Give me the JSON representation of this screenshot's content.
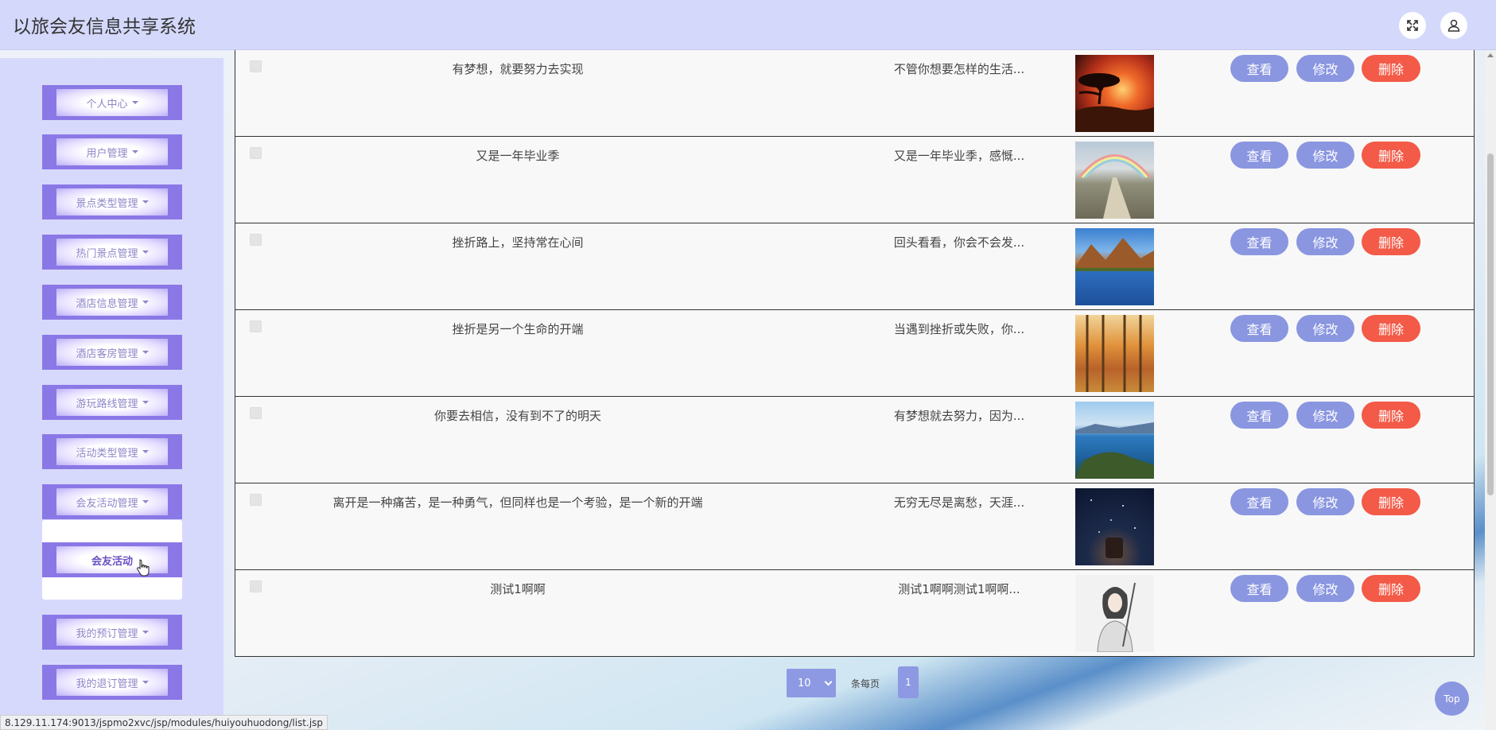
{
  "app": {
    "title": "以旅会友信息共享系统"
  },
  "sidebar": {
    "items": [
      {
        "label": "个人中心"
      },
      {
        "label": "用户管理"
      },
      {
        "label": "景点类型管理"
      },
      {
        "label": "热门景点管理"
      },
      {
        "label": "酒店信息管理"
      },
      {
        "label": "酒店客房管理"
      },
      {
        "label": "游玩路线管理"
      },
      {
        "label": "活动类型管理"
      },
      {
        "label": "会友活动管理"
      },
      {
        "label": "我的预订管理"
      },
      {
        "label": "我的退订管理"
      }
    ],
    "submenu": {
      "label": "会友活动"
    }
  },
  "table": {
    "rows": [
      {
        "title": "有梦想，就要努力去实现",
        "excerpt": "不管你想要怎样的生活...",
        "image": "sunset-tree"
      },
      {
        "title": "又是一年毕业季",
        "excerpt": "又是一年毕业季，感慨...",
        "image": "rainbow-path"
      },
      {
        "title": "挫折路上，坚持常在心间",
        "excerpt": "回头看看，你会不会发...",
        "image": "mountain-lake"
      },
      {
        "title": "挫折是另一个生命的开端",
        "excerpt": "当遇到挫折或失败，你...",
        "image": "autumn-forest"
      },
      {
        "title": "你要去相信，没有到不了的明天",
        "excerpt": "有梦想就去努力，因为...",
        "image": "lake-island"
      },
      {
        "title": "离开是一种痛苦，是一种勇气，但同样也是一个考验，是一个新的开端",
        "excerpt": "无穷无尽是离愁，天涯...",
        "image": "night-lantern"
      },
      {
        "title": "测试1啊啊",
        "excerpt": "测试1啊啊测试1啊啊...",
        "image": "anime-swordsman"
      }
    ],
    "actions": {
      "view": "查看",
      "edit": "修改",
      "delete": "删除"
    }
  },
  "pager": {
    "page_size": "10",
    "page_size_label": "条每页",
    "current_page": "1"
  },
  "top_button": "Top",
  "status_url": "8.129.11.174:9013/jspmo2xvc/jsp/modules/huiyouhuodong/list.jsp",
  "colors": {
    "header": "#d4d8fb",
    "sidebar": "#d7d9fc",
    "menu": "#8a78e6",
    "primary": "#8a96e0",
    "danger": "#f35a47"
  },
  "icons": {
    "fullscreen": "fullscreen-icon",
    "user": "user-icon"
  }
}
